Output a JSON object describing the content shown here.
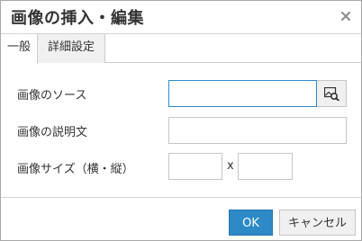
{
  "dialog": {
    "title": "画像の挿入・編集",
    "close_icon": "close-icon"
  },
  "tabs": [
    {
      "label": "一般",
      "active": true
    },
    {
      "label": "詳細設定",
      "active": false
    }
  ],
  "form": {
    "source_label": "画像のソース",
    "source_value": "",
    "browse_icon": "image-browse-icon",
    "description_label": "画像の説明文",
    "description_value": "",
    "size_label": "画像サイズ（横・縦）",
    "width_value": "",
    "height_value": "",
    "times": "x"
  },
  "buttons": {
    "ok": "OK",
    "cancel": "キャンセル"
  },
  "colors": {
    "accent": "#2d8ac7",
    "border": "#c5c5c5",
    "tab_inactive_bg": "#f0f0f0"
  }
}
